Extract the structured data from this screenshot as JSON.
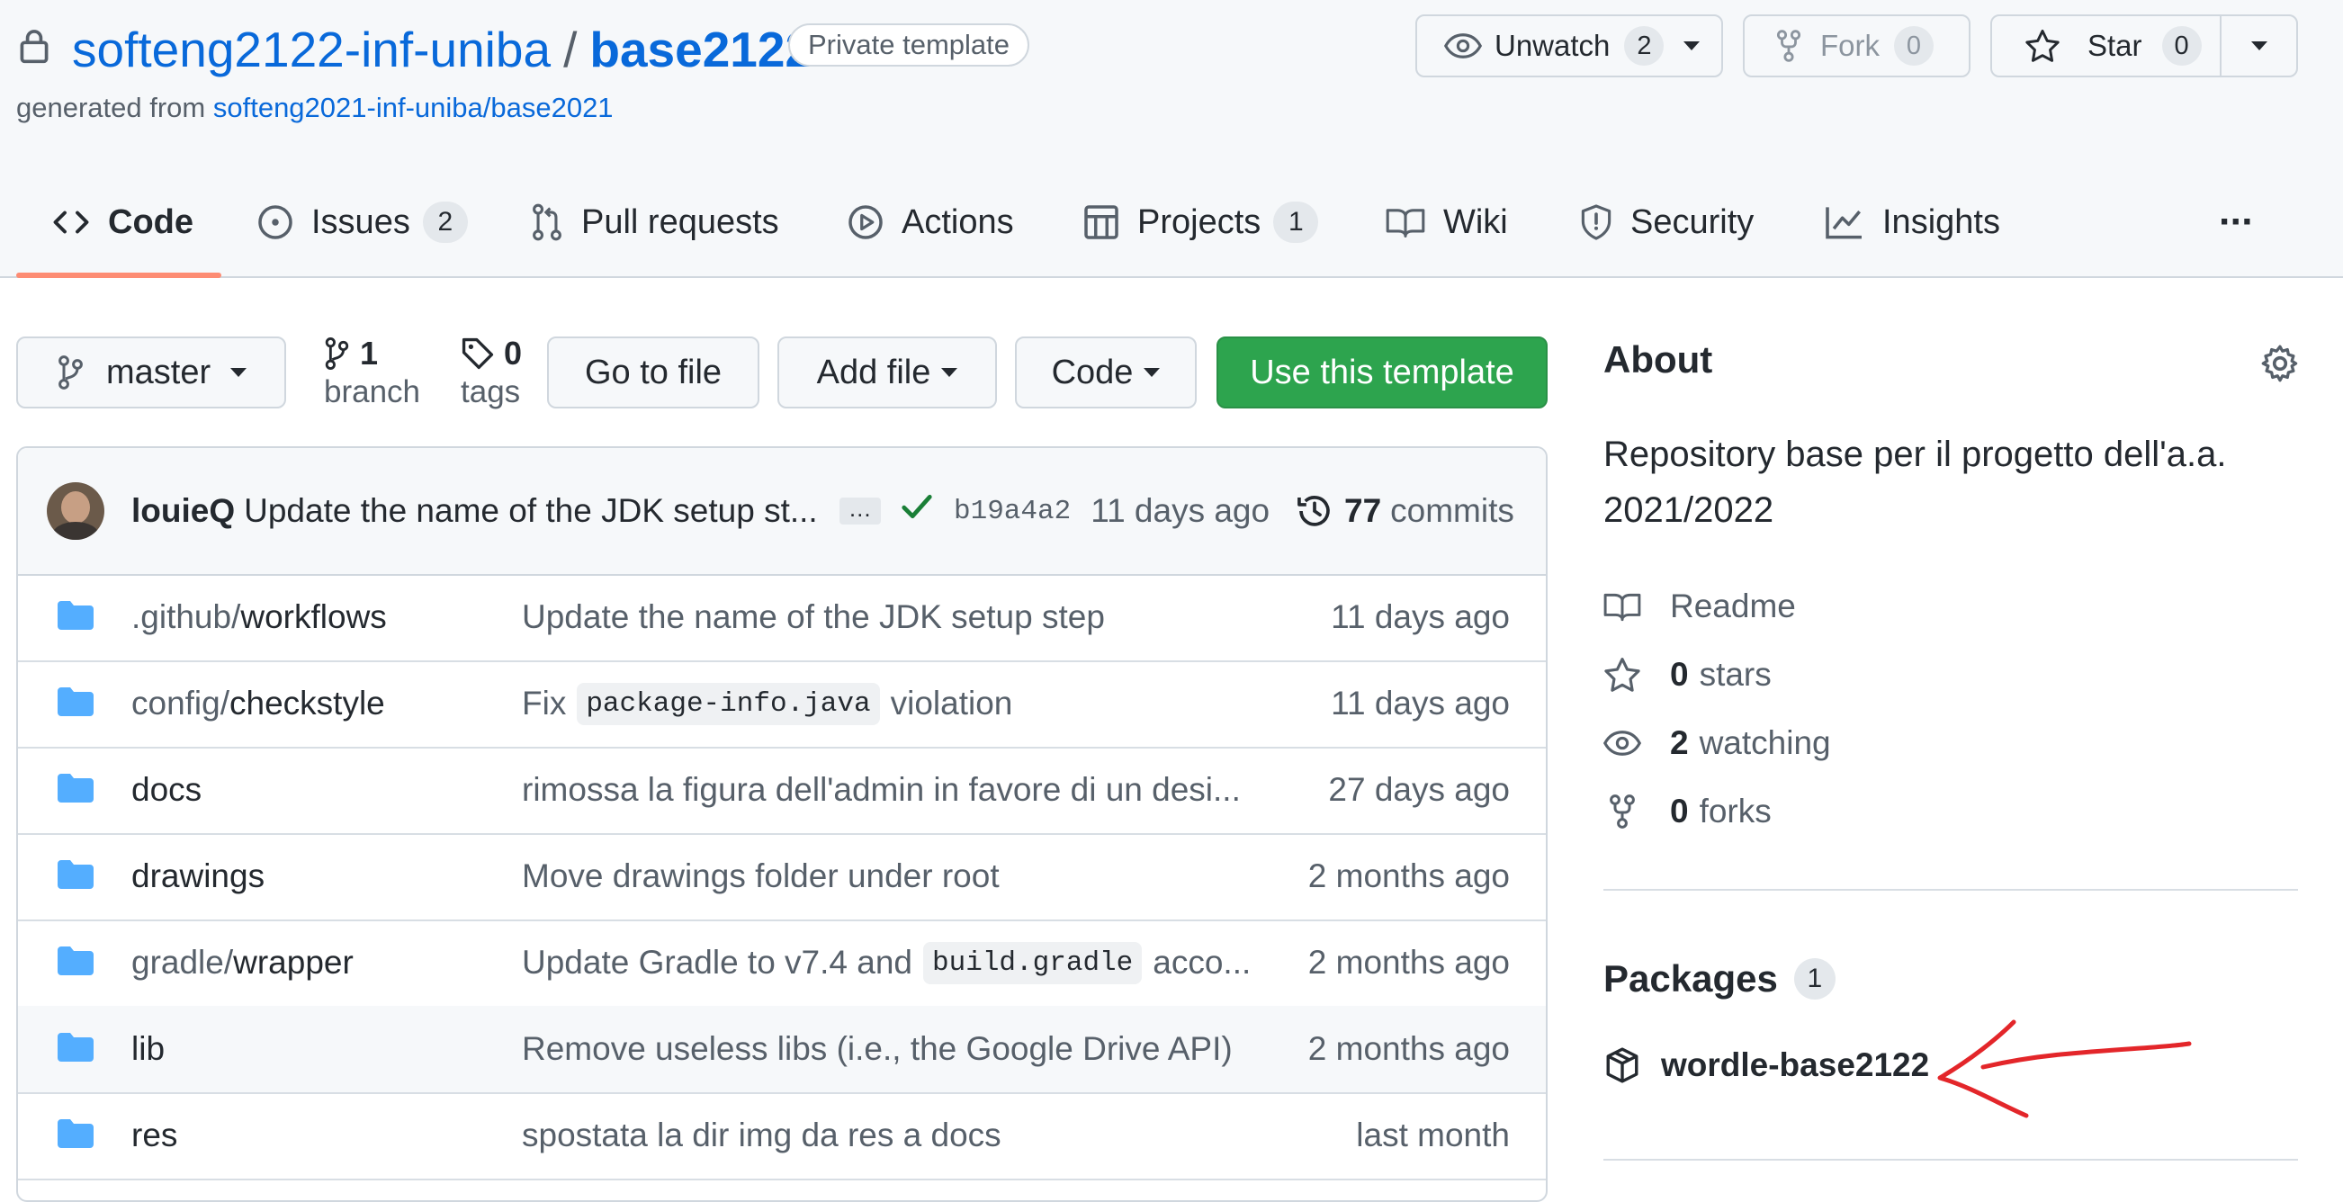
{
  "repo": {
    "owner": "softeng2122-inf-uniba",
    "separator": "/",
    "name": "base2122",
    "visibility": "Private template",
    "generated_from_prefix": "generated from",
    "generated_from_repo": "softeng2021-inf-uniba/base2021"
  },
  "header_actions": {
    "unwatch_label": "Unwatch",
    "unwatch_count": "2",
    "fork_label": "Fork",
    "fork_count": "0",
    "star_label": "Star",
    "star_count": "0"
  },
  "tabs": [
    {
      "label": "Code",
      "icon": "code-icon",
      "active": true
    },
    {
      "label": "Issues",
      "icon": "issue-icon",
      "count": "2"
    },
    {
      "label": "Pull requests",
      "icon": "pull-request-icon"
    },
    {
      "label": "Actions",
      "icon": "play-icon"
    },
    {
      "label": "Projects",
      "icon": "project-icon",
      "count": "1"
    },
    {
      "label": "Wiki",
      "icon": "book-icon"
    },
    {
      "label": "Security",
      "icon": "shield-icon"
    },
    {
      "label": "Insights",
      "icon": "graph-icon"
    }
  ],
  "more_label": "···",
  "toolbar": {
    "branch_name": "master",
    "branch_count": "1",
    "branch_label": "branch",
    "tag_count": "0",
    "tag_label": "tags",
    "go_to_file": "Go to file",
    "add_file": "Add file",
    "code": "Code",
    "use_template": "Use this template"
  },
  "latest_commit": {
    "author": "louieQ",
    "message": "Update the name of the JDK setup st...",
    "ellipsis": "…",
    "sha": "b19a4a2",
    "age": "11 days ago",
    "commit_count": "77",
    "commits_label": "commits"
  },
  "files": [
    {
      "prefix": ".github/",
      "name": "workflows",
      "msg_before": "Update the name of the JDK setup step",
      "code": "",
      "msg_after": "",
      "age": "11 days ago"
    },
    {
      "prefix": "config/",
      "name": "checkstyle",
      "msg_before": "Fix",
      "code": "package-info.java",
      "msg_after": "violation",
      "age": "11 days ago"
    },
    {
      "prefix": "",
      "name": "docs",
      "msg_before": "rimossa la figura dell'admin in favore di un desi...",
      "code": "",
      "msg_after": "",
      "age": "27 days ago"
    },
    {
      "prefix": "",
      "name": "drawings",
      "msg_before": "Move drawings folder under root",
      "code": "",
      "msg_after": "",
      "age": "2 months ago"
    },
    {
      "prefix": "gradle/",
      "name": "wrapper",
      "msg_before": "Update Gradle to v7.4 and",
      "code": "build.gradle",
      "msg_after": "acco...",
      "age": "2 months ago"
    },
    {
      "prefix": "",
      "name": "lib",
      "msg_before": "Remove useless libs (i.e., the Google Drive API)",
      "code": "",
      "msg_after": "",
      "age": "2 months ago"
    },
    {
      "prefix": "",
      "name": "res",
      "msg_before": "spostata la dir img da res a docs",
      "code": "",
      "msg_after": "",
      "age": "last month"
    }
  ],
  "about": {
    "title": "About",
    "description": "Repository base per il progetto dell'a.a. 2021/2022",
    "readme": "Readme",
    "stars_count": "0",
    "stars_label": "stars",
    "watching_count": "2",
    "watching_label": "watching",
    "forks_count": "0",
    "forks_label": "forks"
  },
  "packages": {
    "title": "Packages",
    "count": "1",
    "items": [
      "wordle-base2122"
    ]
  },
  "colors": {
    "accent_link": "#0969da",
    "primary_green": "#2da44e",
    "tab_underline": "#fd8c73",
    "annotation_red": "#e3262a"
  }
}
